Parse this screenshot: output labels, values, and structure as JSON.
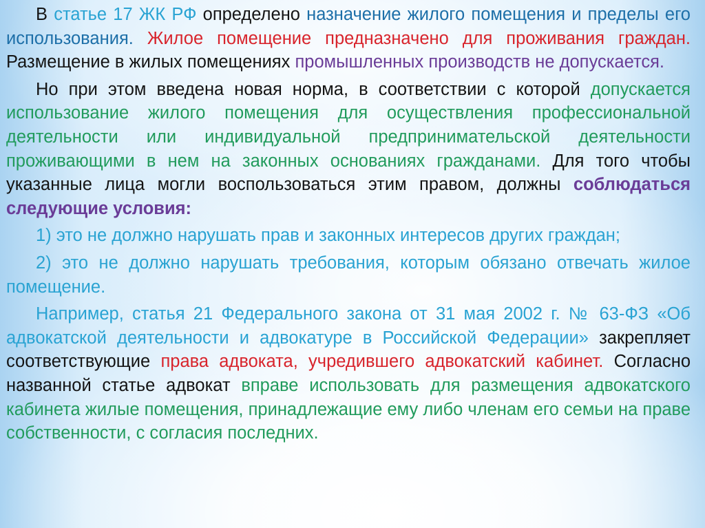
{
  "document": {
    "paragraphs": [
      {
        "id": "art17",
        "segments": [
          {
            "text": "В ",
            "color": "black"
          },
          {
            "text": "статье 17 ЖК РФ",
            "color": "cyan"
          },
          {
            "text": " определено ",
            "color": "black"
          },
          {
            "text": "назначение жилого помещения и пределы его использования.",
            "color": "blue"
          },
          {
            "text": " ",
            "color": "black"
          },
          {
            "text": "Жилое помещение предназначено для проживания граждан.",
            "color": "red"
          },
          {
            "text": " Размещение в жилых помещениях ",
            "color": "black"
          },
          {
            "text": "промышленных производств не допускается.",
            "color": "purple"
          }
        ]
      },
      {
        "id": "new-norm",
        "segments": [
          {
            "text": "Но при этом введена новая норма, в соответствии с которой ",
            "color": "black"
          },
          {
            "text": "до­пускается использование жилого помещения для осуществления профессиональной деятельности или индивидуальной предпри­нимательской деятельности проживающими в нем на законных основаниях гражданами.",
            "color": "green"
          },
          {
            "text": " Для того чтобы указанные лица могли воспользоваться этим правом, должны ",
            "color": "black"
          },
          {
            "text": "соблюдаться следующие условия:",
            "color": "purple",
            "bold": true
          }
        ]
      },
      {
        "id": "condition-1",
        "segments": [
          {
            "text": "1) это не должно нарушать прав и законных интересов других граждан;",
            "color": "item"
          }
        ]
      },
      {
        "id": "condition-2",
        "segments": [
          {
            "text": "2) это не должно нарушать требования, которым обязано отвечать жилое помещение.",
            "color": "item"
          }
        ]
      },
      {
        "id": "example",
        "segments": [
          {
            "text": "Например, статья 21 Федерального закона от 31 мая 2002 г. № 63-ФЗ «Об адвокатской деятельности и адвокатуре в Российской Федерации»",
            "color": "cyan"
          },
          {
            "text": " закрепляет соответствующие ",
            "color": "black"
          },
          {
            "text": "права адвоката, учредившего адвокатский кабинет.",
            "color": "red"
          },
          {
            "text": " Согласно названной статье адвокат ",
            "color": "black"
          },
          {
            "text": "вправе использовать для размещения адвокатского кабинета жилые помещения, принадлежащие ему либо членам его семьи на праве собственности, с согласия последних.",
            "color": "green"
          }
        ]
      }
    ]
  },
  "colors": {
    "black": "#141414",
    "cyan": "#29a3d3",
    "blue": "#1d6fa8",
    "red": "#d8242c",
    "purple": "#6a3c97",
    "green": "#219b5c",
    "item": "#2aa3d2",
    "background": "#dbeefa"
  }
}
